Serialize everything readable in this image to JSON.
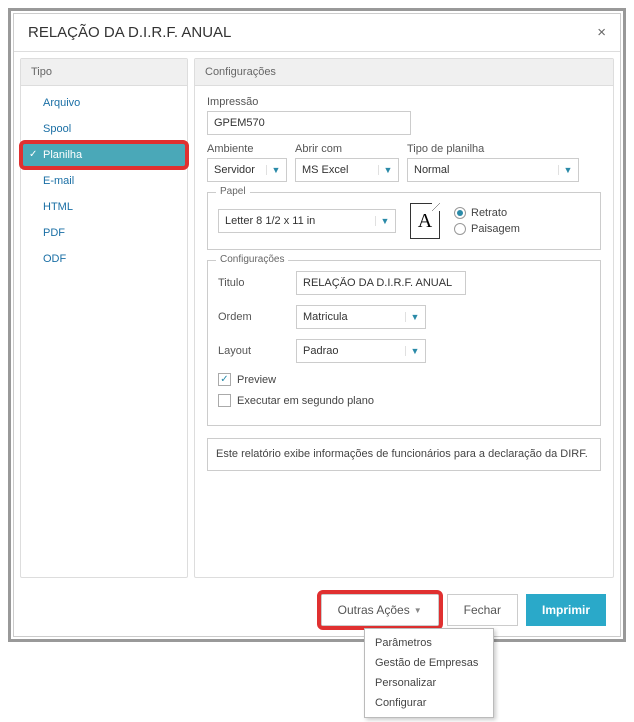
{
  "dialog": {
    "title": "RELAÇÃO DA D.I.R.F. ANUAL",
    "close": "×"
  },
  "sidebar": {
    "header": "Tipo",
    "items": [
      "Arquivo",
      "Spool",
      "Planilha",
      "E-mail",
      "HTML",
      "PDF",
      "ODF"
    ],
    "selected_index": 2
  },
  "config": {
    "header": "Configurações",
    "impressao_label": "Impressão",
    "impressao_value": "GPEM570",
    "ambiente_label": "Ambiente",
    "ambiente_value": "Servidor",
    "abrircom_label": "Abrir com",
    "abrircom_value": "MS Excel",
    "tipoplan_label": "Tipo de planilha",
    "tipoplan_value": "Normal",
    "papel": {
      "legend": "Papel",
      "size": "Letter 8 1/2 x 11 in",
      "orient_portrait": "Retrato",
      "orient_landscape": "Paisagem"
    },
    "inner": {
      "legend": "Configurações",
      "titulo_label": "Titulo",
      "titulo_value": "RELAÇÃO DA D.I.R.F. ANUAL",
      "ordem_label": "Ordem",
      "ordem_value": "Matricula",
      "layout_label": "Layout",
      "layout_value": "Padrao",
      "preview_label": "Preview",
      "bg_label": "Executar em segundo plano"
    },
    "description": "Este relatório exibe informações de funcionários para a declaração da DIRF."
  },
  "footer": {
    "outras": "Outras Ações",
    "fechar": "Fechar",
    "imprimir": "Imprimir",
    "menu": [
      "Parâmetros",
      "Gestão de Empresas",
      "Personalizar",
      "Configurar"
    ]
  }
}
